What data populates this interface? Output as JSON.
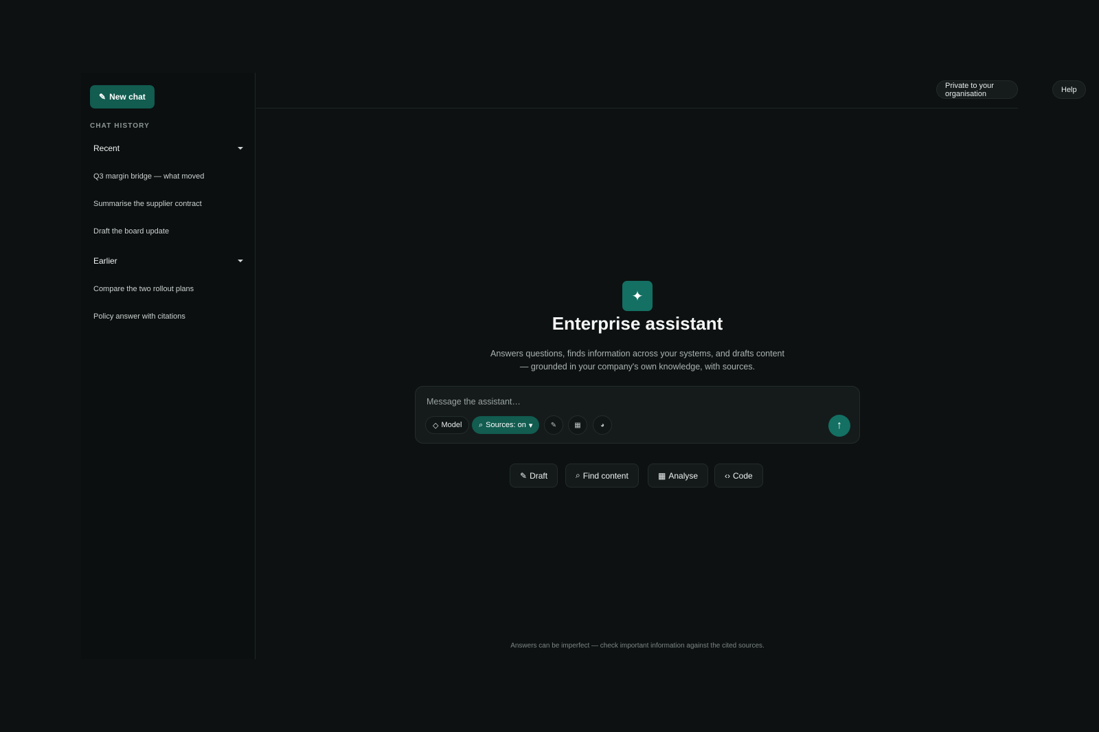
{
  "sidebar": {
    "new_chat": {
      "icon": "✎",
      "label": "New chat"
    },
    "history_title": "CHAT HISTORY",
    "groups": [
      {
        "label": "Recent",
        "items": [
          "Q3 margin bridge — what moved",
          "Summarise the supplier contract",
          "Draft the board update"
        ]
      },
      {
        "label": "Earlier",
        "items": [
          "Compare the two rollout plans",
          "Policy answer with citations"
        ]
      }
    ]
  },
  "topbar": {
    "privacy_label": "Private to your organisation",
    "help_label": "Help"
  },
  "hero": {
    "logo_icon": "✦",
    "title": "Enterprise assistant",
    "subtitle_line1": "Answers questions, finds information across your systems, and drafts content",
    "subtitle_line2": "— grounded in your company's own knowledge, with sources."
  },
  "composer": {
    "placeholder": "Message the assistant…",
    "model": {
      "icon": "◇",
      "label": "Model"
    },
    "sources": {
      "icon": "⌕",
      "label": "Sources: on",
      "caret": "▾"
    },
    "tools": [
      {
        "name": "pencil-icon",
        "glyph": "✎"
      },
      {
        "name": "table-icon",
        "glyph": "▦"
      },
      {
        "name": "globe-icon",
        "glyph": "◕"
      }
    ],
    "send_icon": "↑"
  },
  "actions": [
    {
      "icon": "✎",
      "label": "Draft"
    },
    {
      "icon": "⌕",
      "label": "Find content"
    },
    {
      "icon": "▦",
      "label": "Analyse"
    },
    {
      "icon": "‹›",
      "label": "Code"
    }
  ],
  "footer_note": "Answers can be imperfect — check important information against the cited sources.",
  "colors": {
    "background": "#0d1111",
    "accent": "#137063",
    "accent_dark": "#125c50"
  }
}
